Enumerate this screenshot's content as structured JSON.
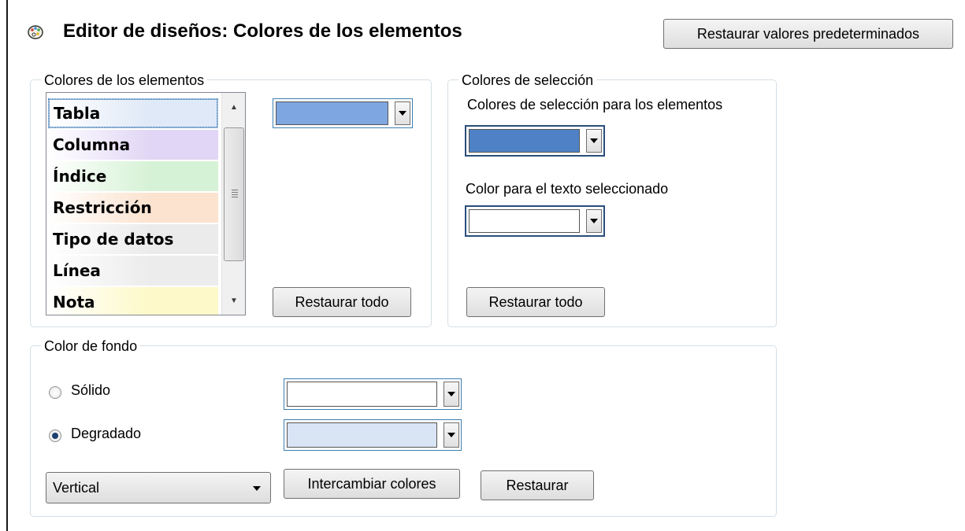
{
  "header": {
    "title": "Editor de diseños: Colores de los elementos",
    "icon": "palette-icon",
    "reset_defaults_label": "Restaurar valores predeterminados"
  },
  "element_colors": {
    "legend": "Colores de los elementos",
    "items": [
      {
        "label": "Tabla",
        "color": "#dfe9f7",
        "selected": true
      },
      {
        "label": "Columna",
        "color": "#e1d6f5"
      },
      {
        "label": "Índice",
        "color": "#d6f2d6"
      },
      {
        "label": "Restricción",
        "color": "#fbe3cf"
      },
      {
        "label": "Tipo de datos",
        "color": "#ebebeb"
      },
      {
        "label": "Línea",
        "color": "#ececec"
      },
      {
        "label": "Nota",
        "color": "#fdf9c8"
      }
    ],
    "current_color": "#7ea6e0",
    "restore_all_label": "Restaurar todo"
  },
  "selection_colors": {
    "legend": "Colores de selección",
    "element_label": "Colores de selección para los elementos",
    "element_color": "#4f81c6",
    "text_label": "Color para el texto seleccionado",
    "text_color": "#ffffff",
    "restore_all_label": "Restaurar todo"
  },
  "background": {
    "legend": "Color de fondo",
    "solid_label": "Sólido",
    "solid_color": "#ffffff",
    "solid_checked": false,
    "gradient_label": "Degradado",
    "gradient_color": "#d9e4f5",
    "gradient_checked": true,
    "direction_value": "Vertical",
    "swap_label": "Intercambiar colores",
    "restore_label": "Restaurar"
  }
}
